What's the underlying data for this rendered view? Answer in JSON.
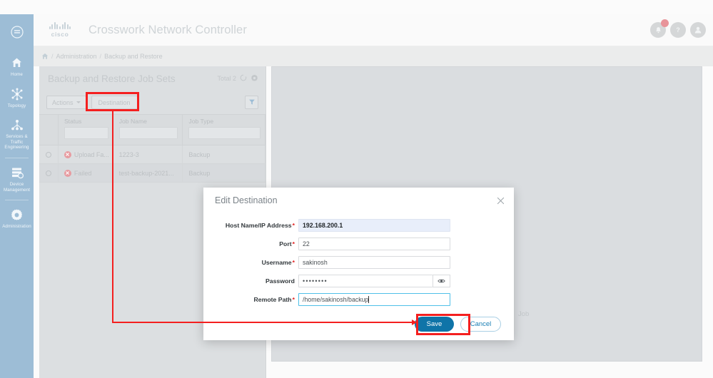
{
  "header": {
    "brand_word": "cisco",
    "app_title": "Crosswork Network Controller",
    "icons": {
      "notifications": "bell-icon",
      "help": "question-mark-icon",
      "user": "user-avatar-icon"
    }
  },
  "breadcrumb": {
    "home_icon": "home-icon",
    "sep1": "/",
    "item1": "Administration",
    "sep2": "/",
    "item2": "Backup and Restore"
  },
  "sidebar": {
    "toggle_icon": "menu-collapse-icon",
    "items": [
      {
        "label": "Home",
        "icon": "home-icon"
      },
      {
        "label": "Topology",
        "icon": "topology-icon"
      },
      {
        "label": "Services & Traffic Engineering",
        "icon": "services-traffic-icon"
      },
      {
        "label": "Device Management",
        "icon": "device-management-icon"
      },
      {
        "label": "Administration",
        "icon": "gear-icon"
      }
    ]
  },
  "left_panel": {
    "title": "Backup and Restore Job Sets",
    "total_label": "Total 2",
    "refresh_icon": "refresh-icon",
    "settings_icon": "gear-icon",
    "toolbar": {
      "actions_label": "Actions",
      "destination_label": "Destination",
      "filter_icon": "funnel-icon"
    },
    "table": {
      "columns": [
        "",
        "Status",
        "Job Name",
        "Job Type"
      ],
      "rows": [
        {
          "status": "Upload Fa...",
          "job_name": "1223-3",
          "job_type": "Backup"
        },
        {
          "status": "Failed",
          "job_name": "test-backup-2021...",
          "job_type": "Backup"
        }
      ]
    }
  },
  "right_panel": {
    "partial_text": "Job"
  },
  "modal": {
    "title": "Edit Destination",
    "close_icon": "close-icon",
    "fields": [
      {
        "label": "Host Name/IP Address",
        "required": true,
        "value": "192.168.200.1",
        "state": "highlight"
      },
      {
        "label": "Port",
        "required": true,
        "value": "22",
        "state": "normal"
      },
      {
        "label": "Username",
        "required": true,
        "value": "sakinosh",
        "state": "normal"
      },
      {
        "label": "Password",
        "required": false,
        "value": "••••••••",
        "state": "password",
        "toggle_icon": "eye-icon"
      },
      {
        "label": "Remote Path",
        "required": true,
        "value": "/home/sakinosh/backup",
        "state": "focused"
      }
    ],
    "buttons": {
      "save_label": "Save",
      "cancel_label": "Cancel"
    }
  },
  "colors": {
    "accent_blue": "#0f74a8",
    "annotation_red": "#f41f1f",
    "rail_blue": "#9dbdd6",
    "focus_border": "#4fc0e8",
    "required_red": "#e02020"
  }
}
